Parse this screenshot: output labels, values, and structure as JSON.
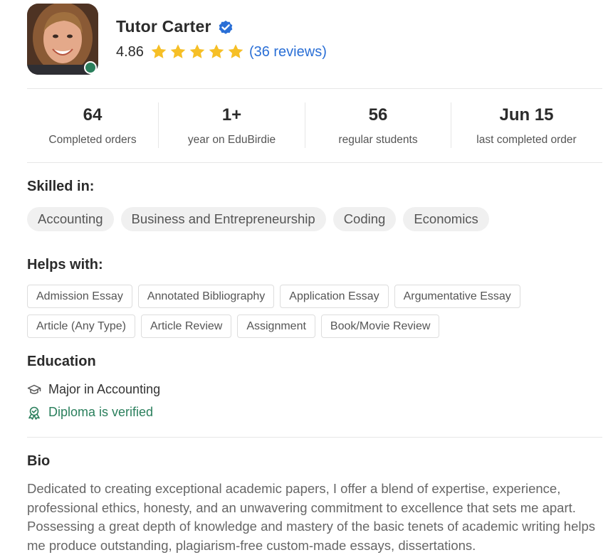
{
  "tutor": {
    "name": "Tutor Carter",
    "rating": "4.86",
    "star_count": 5,
    "reviews": "(36 reviews)"
  },
  "stats": [
    {
      "value": "64",
      "label": "Completed orders"
    },
    {
      "value": "1+",
      "label": "year on EduBirdie"
    },
    {
      "value": "56",
      "label": "regular students"
    },
    {
      "value": "Jun 15",
      "label": "last completed order"
    }
  ],
  "skilled": {
    "title": "Skilled in:",
    "items": [
      "Accounting",
      "Business and Entrepreneurship",
      "Coding",
      "Economics"
    ]
  },
  "helps": {
    "title": "Helps with:",
    "items": [
      "Admission Essay",
      "Annotated Bibliography",
      "Application Essay",
      "Argumentative Essay",
      "Article (Any Type)",
      "Article Review",
      "Assignment",
      "Book/Movie Review"
    ]
  },
  "education": {
    "title": "Education",
    "major": "Major in Accounting",
    "verified": "Diploma is verified"
  },
  "bio": {
    "title": "Bio",
    "text": "Dedicated to creating exceptional academic papers, I offer a blend of expertise, experience, professional ethics, honesty, and an unwavering commitment to excellence that sets me apart. Possessing a great depth of knowledge and mastery of the basic tenets of academic writing helps me produce outstanding, plagiarism-free custom-made essays, dissertations."
  },
  "colors": {
    "accent": "#2a6fd6",
    "star": "#f6bf26",
    "verified_green": "#2a7f5c",
    "online": "#2a7f5c"
  }
}
